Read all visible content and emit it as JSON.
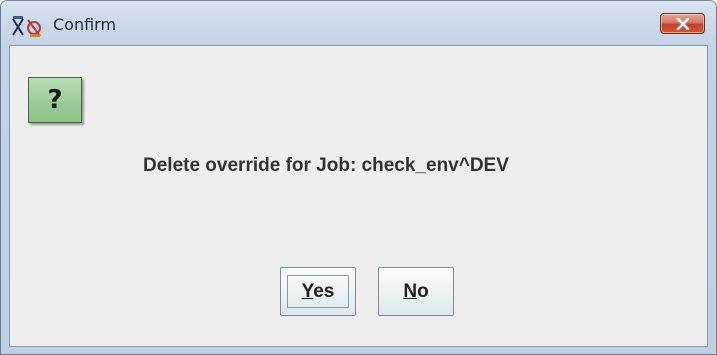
{
  "window": {
    "title": "Confirm"
  },
  "dialog": {
    "icon": "question-icon",
    "icon_glyph": "?",
    "message": "Delete override for Job: check_env^DEV"
  },
  "buttons": {
    "yes": {
      "mnemonic": "Y",
      "rest": "es"
    },
    "no": {
      "mnemonic": "N",
      "rest": "o"
    }
  },
  "colors": {
    "client_background": "#eeeeee",
    "close_button": "#c2412a",
    "question_icon": "#9ccc98"
  }
}
